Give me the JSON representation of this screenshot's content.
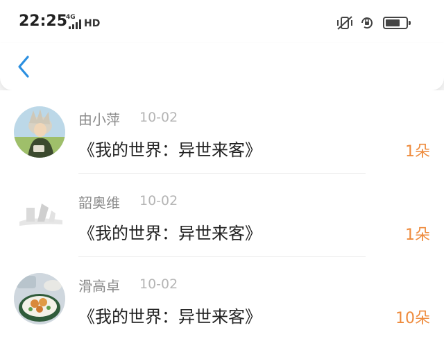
{
  "status_bar": {
    "time": "22:25",
    "network": "4G",
    "hd": "HD",
    "icons": [
      "signal-icon",
      "vibrate-off-icon",
      "rotation-lock-icon",
      "battery-icon"
    ]
  },
  "nav": {
    "back_icon": "chevron-left-icon",
    "accent": "#2b8fe0"
  },
  "list": {
    "items": [
      {
        "name": "由小萍",
        "date": "10-02",
        "title": "《我的世界：异世来客》",
        "amount": "1朵"
      },
      {
        "name": "韶奥维",
        "date": "10-02",
        "title": "《我的世界：异世来客》",
        "amount": "1朵"
      },
      {
        "name": "滑高卓",
        "date": "10-02",
        "title": "《我的世界：异世来客》",
        "amount": "10朵"
      }
    ]
  },
  "colors": {
    "amount": "#ee8a3b",
    "name": "#8a8a8a",
    "date": "#b5b5b5",
    "title": "#222222"
  }
}
